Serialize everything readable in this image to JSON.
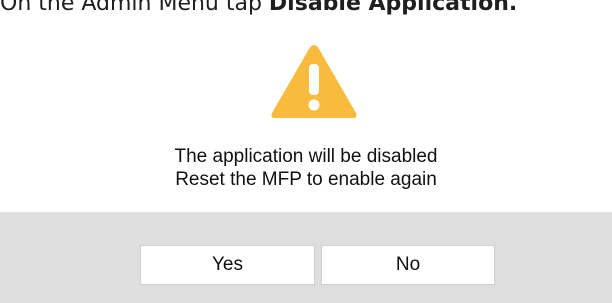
{
  "instruction": {
    "prefix": "On the Admin Menu tap ",
    "bold": "Disable Application."
  },
  "dialog": {
    "icon": "warning-triangle-icon",
    "icon_color": "#f8bb3e",
    "message_line1": "The application will be disabled",
    "message_line2": "Reset the MFP to enable again",
    "yes_label": "Yes",
    "no_label": "No"
  }
}
